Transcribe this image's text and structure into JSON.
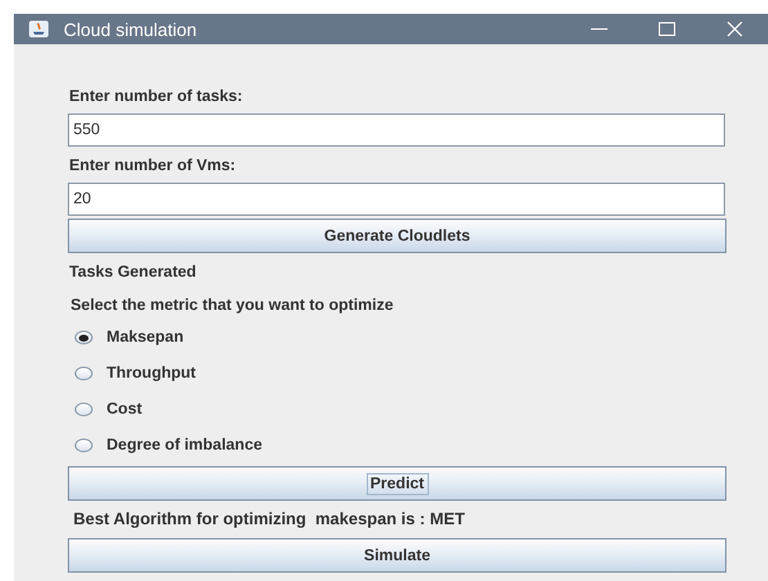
{
  "window": {
    "title": "Cloud simulation"
  },
  "tasks_label": "Enter number of tasks:",
  "tasks_field": {
    "value": "550"
  },
  "vms_label": "Enter number of Vms:",
  "vms_field": {
    "value": "20"
  },
  "generate_button": {
    "label": "Generate Cloudlets",
    "focused": false
  },
  "status": "Tasks Generated",
  "metric_prompt": "Select the metric that you want to optimize",
  "metrics": [
    {
      "label": "Maksepan",
      "selected": true
    },
    {
      "label": "Throughput",
      "selected": false
    },
    {
      "label": "Cost",
      "selected": false
    },
    {
      "label": "Degree of imbalance",
      "selected": false
    }
  ],
  "predict_button": {
    "label": "Predict",
    "focused": true
  },
  "result": "Best Algorithm for optimizing  makespan is : MET",
  "simulate_button": {
    "label": "Simulate",
    "focused": false
  }
}
